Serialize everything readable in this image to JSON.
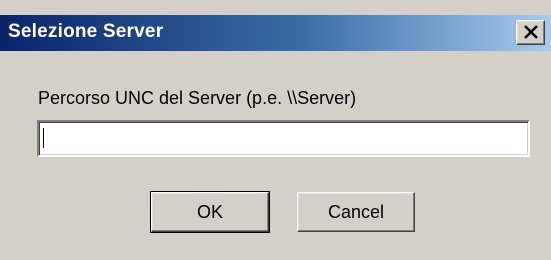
{
  "window": {
    "title": "Selezione Server",
    "close_icon": "close-icon"
  },
  "form": {
    "label": "Percorso UNC del Server (p.e. \\\\Server)",
    "input_value": "",
    "input_placeholder": ""
  },
  "buttons": {
    "ok_label": "OK",
    "cancel_label": "Cancel"
  },
  "colors": {
    "title_gradient_start": "#0a246a",
    "title_gradient_end": "#a6caf0",
    "face": "#d4d0c8"
  }
}
